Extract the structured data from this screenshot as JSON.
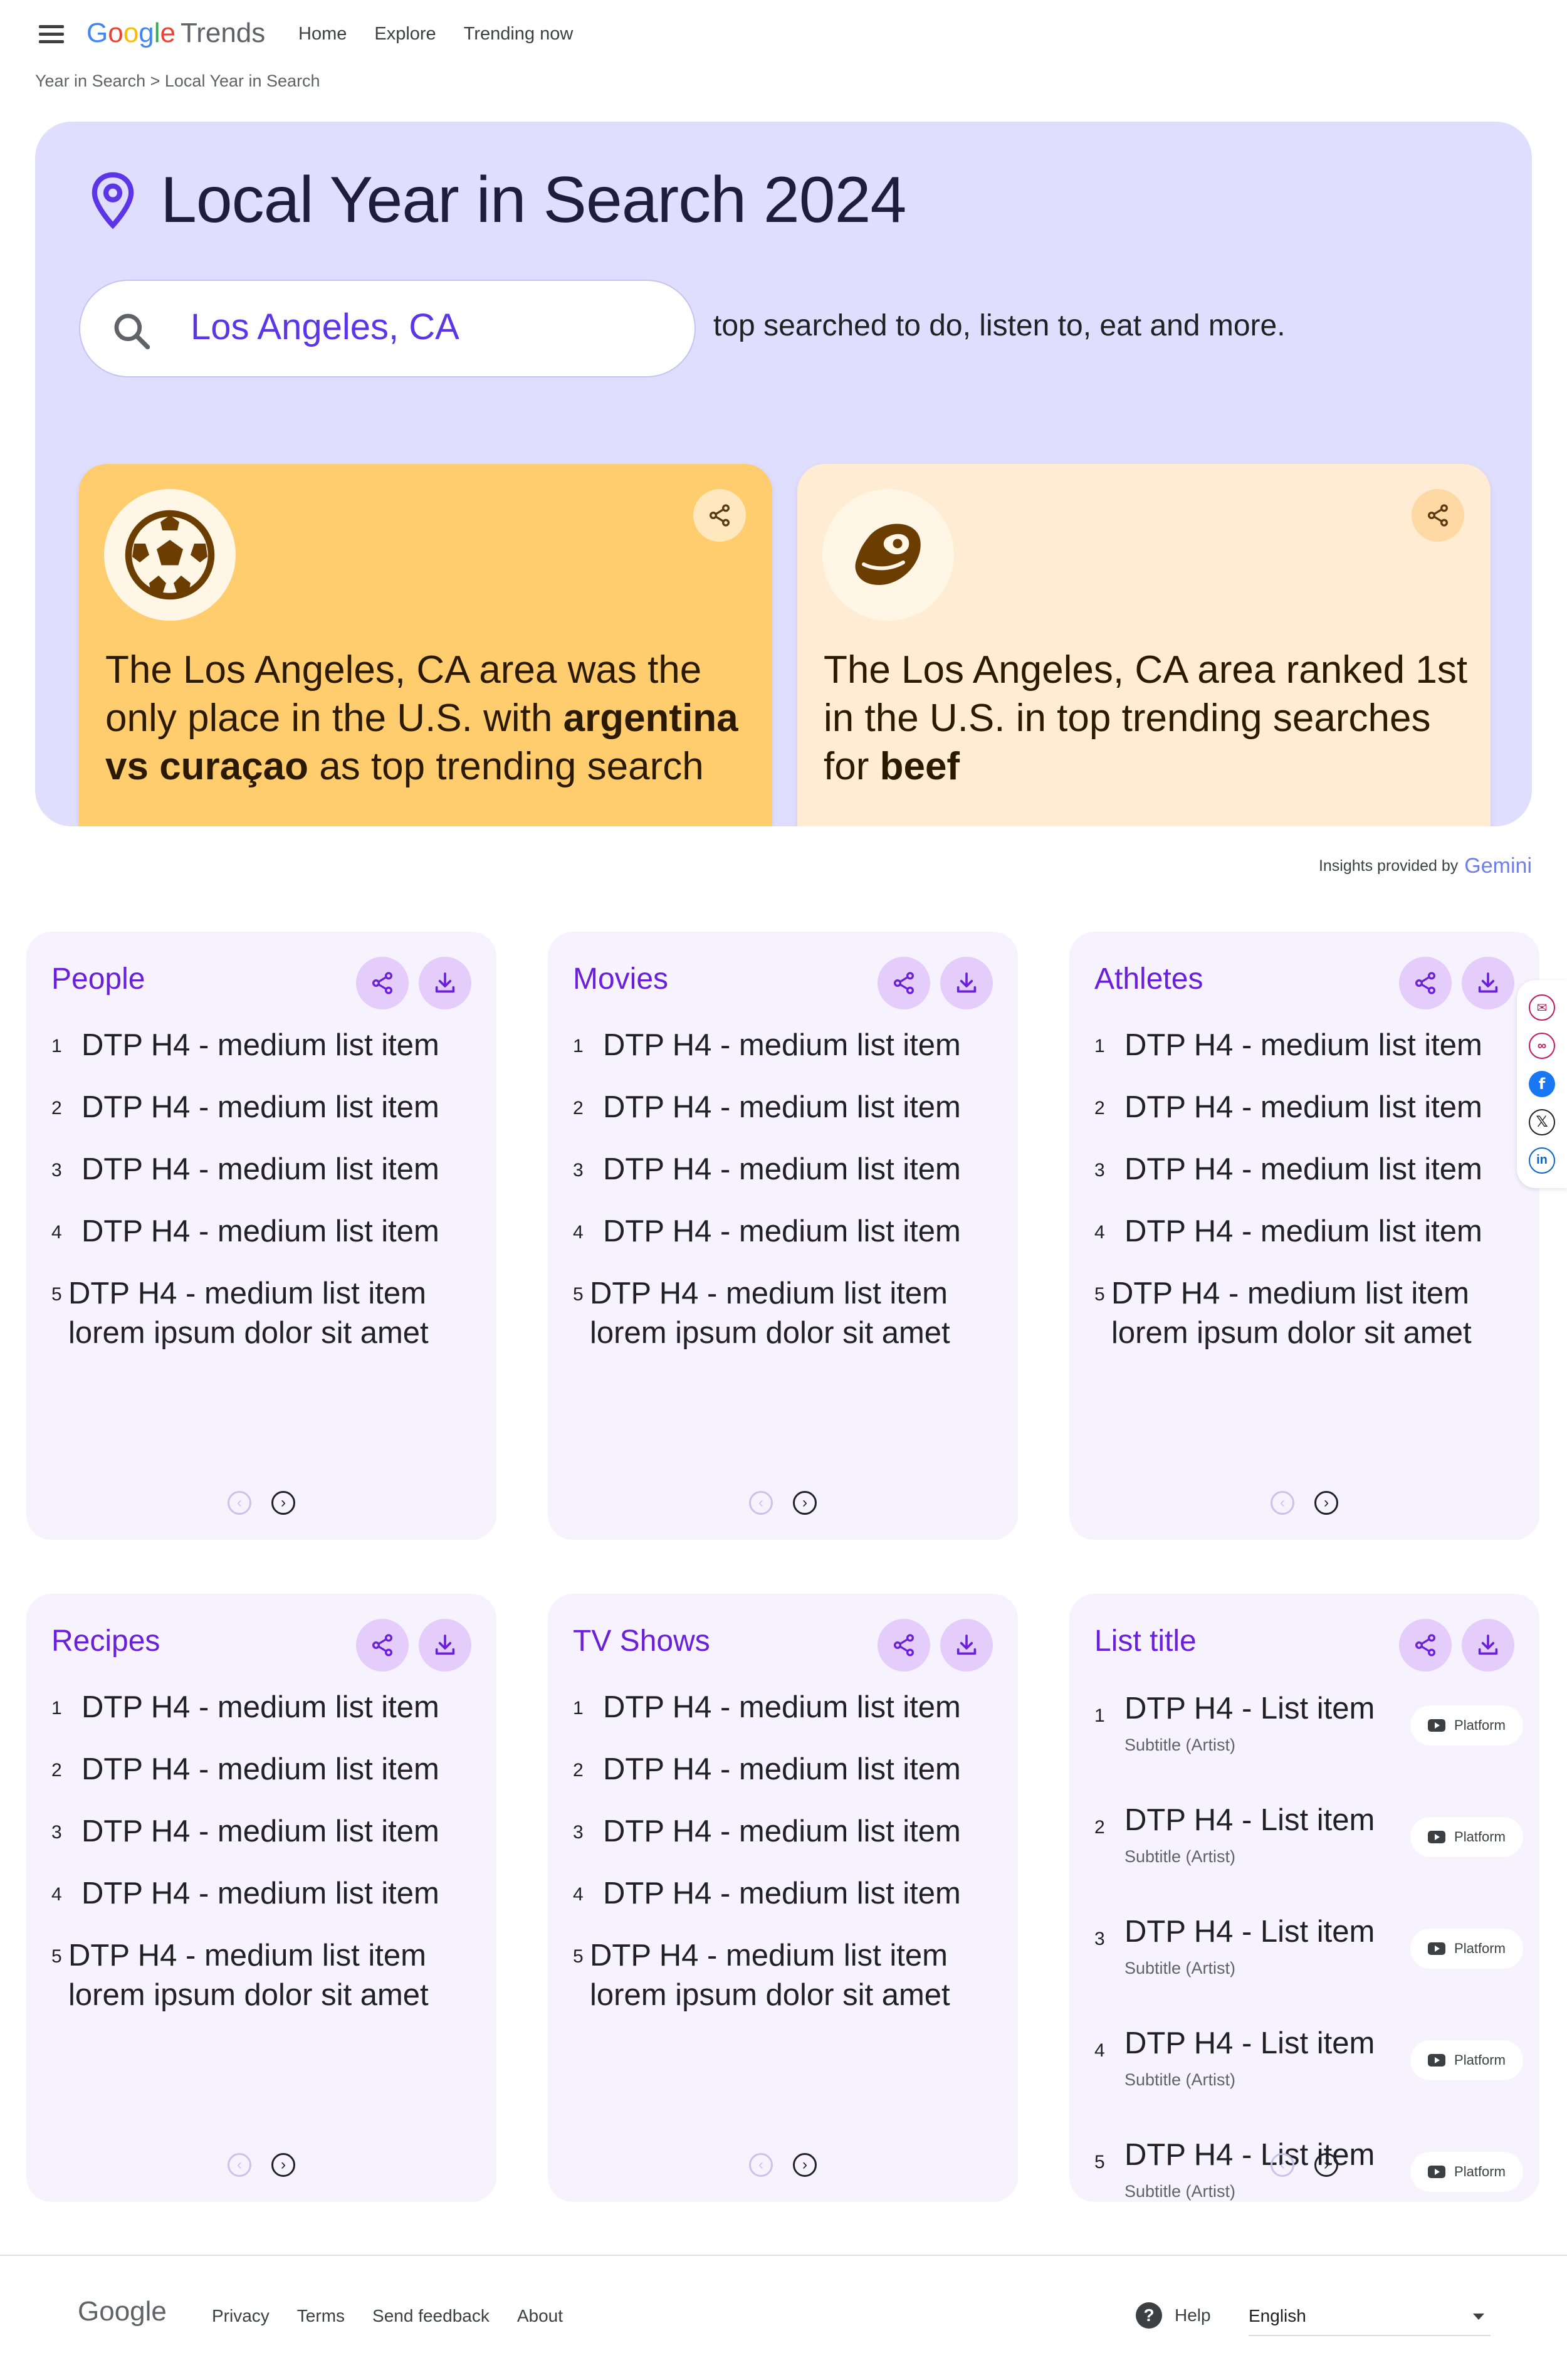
{
  "header": {
    "logo_google": [
      "G",
      "o",
      "o",
      "g",
      "l",
      "e"
    ],
    "logo_trends": "Trends",
    "nav": [
      "Home",
      "Explore",
      "Trending now"
    ]
  },
  "breadcrumb": "Year in Search > Local Year in Search",
  "hero": {
    "title": "Local Year in Search 2024",
    "location": "Los Angeles, CA",
    "tagline": "top searched to do, listen to, eat and more.",
    "insights": [
      {
        "icon": "soccer-ball-icon",
        "pre": "The Los Angeles, CA area was the only place in the U.S. with ",
        "bold": "argentina vs curaçao",
        "post": " as top trending search"
      },
      {
        "icon": "steak-icon",
        "pre": "The Los Angeles, CA area ranked 1st in the U.S. in top trending searches for ",
        "bold": "beef",
        "post": ""
      }
    ]
  },
  "gemini": {
    "label": "Insights provided by",
    "brand": "Gemini"
  },
  "cards": [
    {
      "title": "People",
      "items": [
        "DTP H4 - medium list item",
        "DTP H4 - medium list item",
        "DTP H4 - medium list item",
        "DTP H4 - medium list item",
        "DTP H4 - medium list item lorem ipsum dolor sit amet"
      ]
    },
    {
      "title": "Movies",
      "items": [
        "DTP H4 - medium list item",
        "DTP H4 - medium list item",
        "DTP H4 - medium list item",
        "DTP H4 - medium list item",
        "DTP H4 - medium list item lorem ipsum dolor sit amet"
      ]
    },
    {
      "title": "Athletes",
      "items": [
        "DTP H4 - medium list item",
        "DTP H4 - medium list item",
        "DTP H4 - medium list item",
        "DTP H4 - medium list item",
        "DTP H4 - medium list item lorem ipsum dolor sit amet"
      ]
    },
    {
      "title": "Recipes",
      "items": [
        "DTP H4 - medium list item",
        "DTP H4 - medium list item",
        "DTP H4 - medium list item",
        "DTP H4 - medium list item",
        "DTP H4 - medium list item lorem ipsum dolor sit amet"
      ]
    },
    {
      "title": "TV Shows",
      "items": [
        "DTP H4 - medium list item",
        "DTP H4 - medium list item",
        "DTP H4 - medium list item",
        "DTP H4 - medium list item",
        "DTP H4 - medium list item lorem ipsum dolor sit amet"
      ]
    }
  ],
  "list_card": {
    "title": "List title",
    "items": [
      {
        "title": "DTP H4 - List item",
        "subtitle": "Subtitle (Artist)",
        "platform": "Platform"
      },
      {
        "title": "DTP H4 - List item",
        "subtitle": "Subtitle (Artist)",
        "platform": "Platform"
      },
      {
        "title": "DTP H4 - List item",
        "subtitle": "Subtitle (Artist)",
        "platform": "Platform"
      },
      {
        "title": "DTP H4 - List item",
        "subtitle": "Subtitle (Artist)",
        "platform": "Platform"
      },
      {
        "title": "DTP H4 - List item",
        "subtitle": "Subtitle (Artist)",
        "platform": "Platform"
      }
    ]
  },
  "social": [
    "email-icon",
    "link-icon",
    "facebook-icon",
    "x-icon",
    "linkedin-icon"
  ],
  "footer": {
    "logo": "Google",
    "links": [
      "Privacy",
      "Terms",
      "Send feedback",
      "About"
    ],
    "help": "Help",
    "language": "English"
  },
  "colors": {
    "accent": "#6a1fd9",
    "hero_bg": "#e0deff",
    "card_bg": "#f6f3ff",
    "insight_orange": "#ffcc6e",
    "insight_peach": "#ffecd2"
  }
}
